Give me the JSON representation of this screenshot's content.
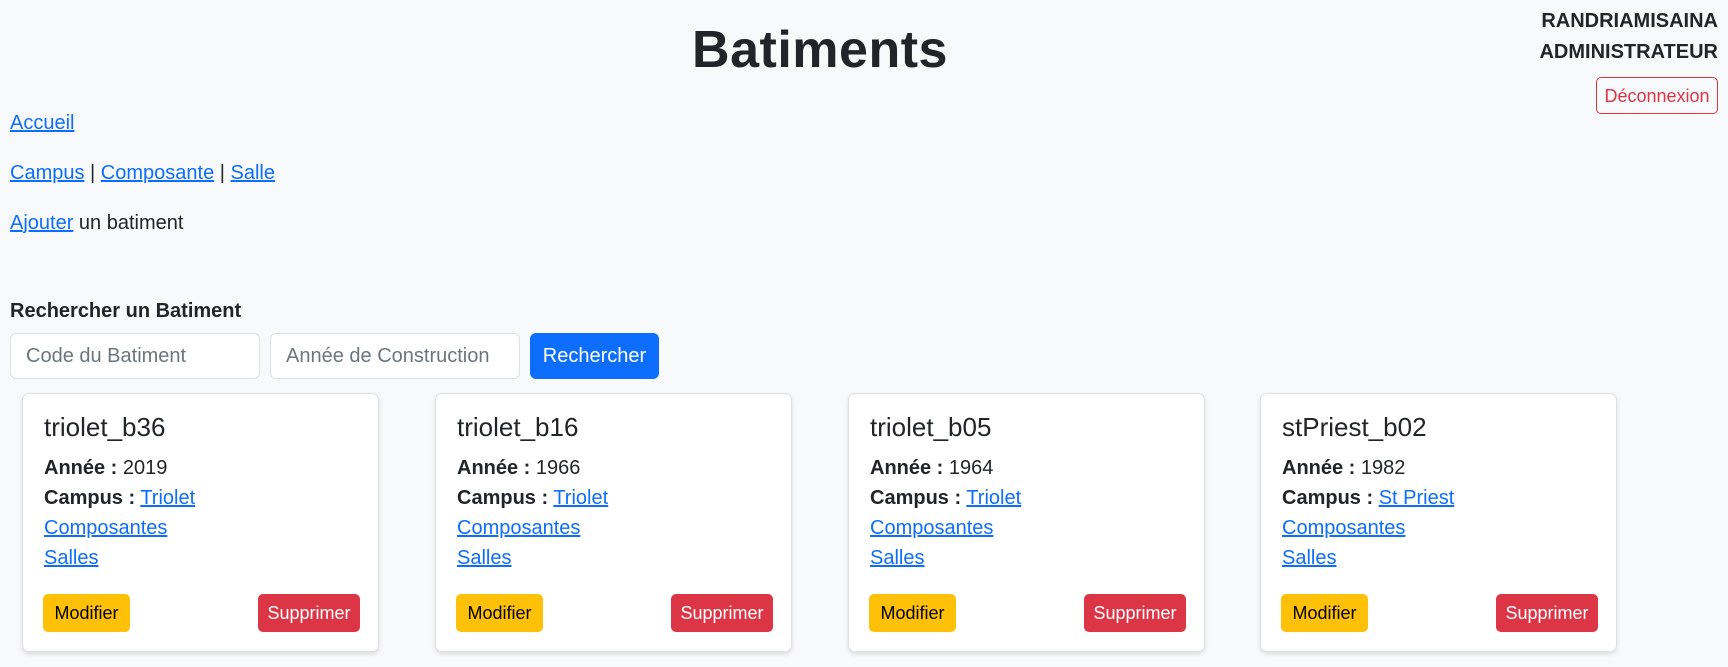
{
  "page": {
    "title": "Batiments"
  },
  "user": {
    "name": "RANDRIAMISAINA",
    "role": "ADMINISTRATEUR",
    "logout_label": "Déconnexion"
  },
  "nav": {
    "home": "Accueil",
    "campus": "Campus",
    "composante": "Composante",
    "salle": "Salle",
    "separator": " | "
  },
  "add": {
    "link": "Ajouter",
    "suffix": " un batiment"
  },
  "search": {
    "label": "Rechercher un Batiment",
    "code_placeholder": "Code du Batiment",
    "year_placeholder": "Année de Construction",
    "button": "Rechercher"
  },
  "labels": {
    "year": "Année :",
    "campus": "Campus :",
    "composantes": "Composantes",
    "salles": "Salles",
    "modify": "Modifier",
    "delete": "Supprimer"
  },
  "buildings": [
    {
      "code": "triolet_b36",
      "year": "2019",
      "campus": "Triolet"
    },
    {
      "code": "triolet_b16",
      "year": "1966",
      "campus": "Triolet"
    },
    {
      "code": "triolet_b05",
      "year": "1964",
      "campus": "Triolet"
    },
    {
      "code": "stPriest_b02",
      "year": "1982",
      "campus": "St Priest"
    }
  ],
  "colors": {
    "primary": "#0d6efd",
    "danger": "#dc3545",
    "warning": "#ffc107",
    "background": "#f8f9fa"
  }
}
